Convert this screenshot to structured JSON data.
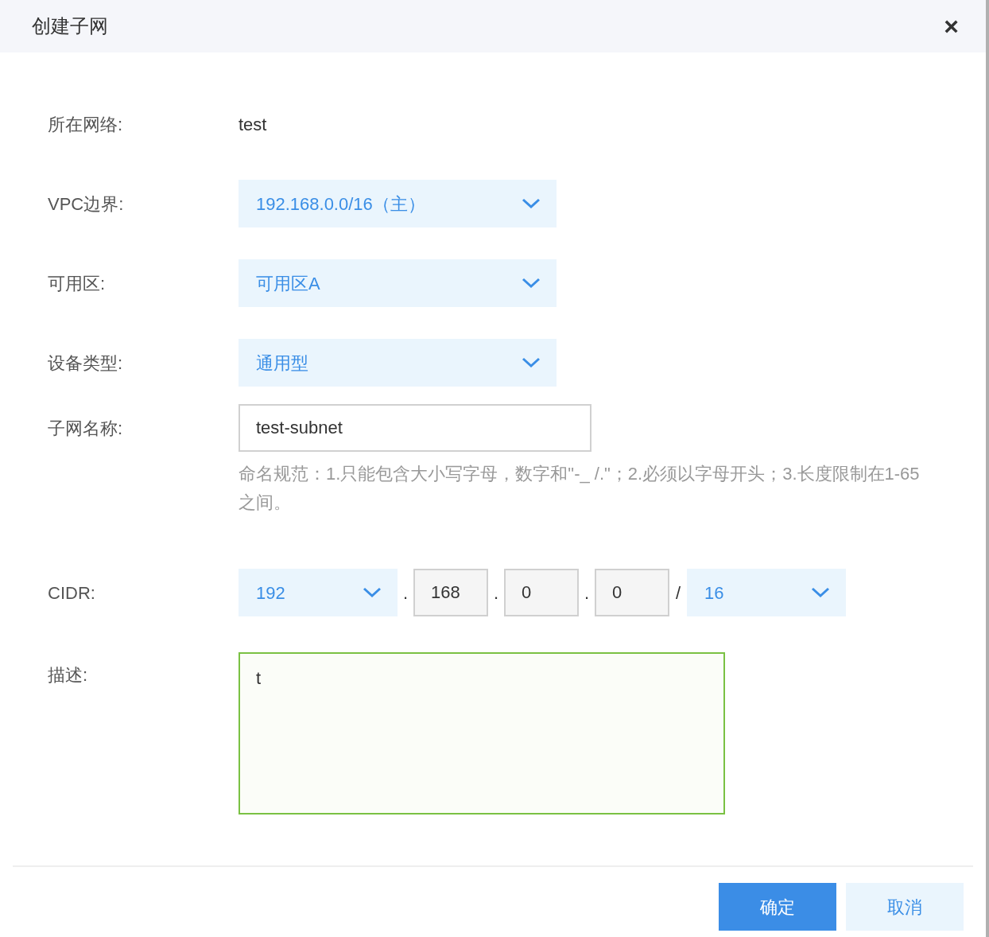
{
  "dialog": {
    "title": "创建子网",
    "close": "×"
  },
  "fields": [
    {
      "kind": "text",
      "label": "所在网络:",
      "value": "test"
    },
    {
      "kind": "select",
      "label": "VPC边界:",
      "value": "192.168.0.0/16（主）"
    },
    {
      "kind": "select",
      "label": "可用区:",
      "value": "可用区A"
    },
    {
      "kind": "select",
      "label": "设备类型:",
      "value": "通用型"
    },
    {
      "kind": "input",
      "label": "子网名称:",
      "value": "test-subnet",
      "hint": "命名规范：1.只能包含大小写字母，数字和\"-_ /.\"；2.必须以字母开头；3.长度限制在1-65之间。"
    },
    {
      "kind": "cidr",
      "label": "CIDR:",
      "first": "192",
      "parts": [
        ".",
        "168",
        ".",
        "0",
        ".",
        "0"
      ],
      "slash": "/",
      "mask": "16"
    },
    {
      "kind": "textarea",
      "label": "描述:",
      "value": "t",
      "focused": true
    }
  ],
  "buttons": [
    {
      "label": "确定",
      "primary": true
    },
    {
      "label": "取消",
      "primary": false
    }
  ]
}
